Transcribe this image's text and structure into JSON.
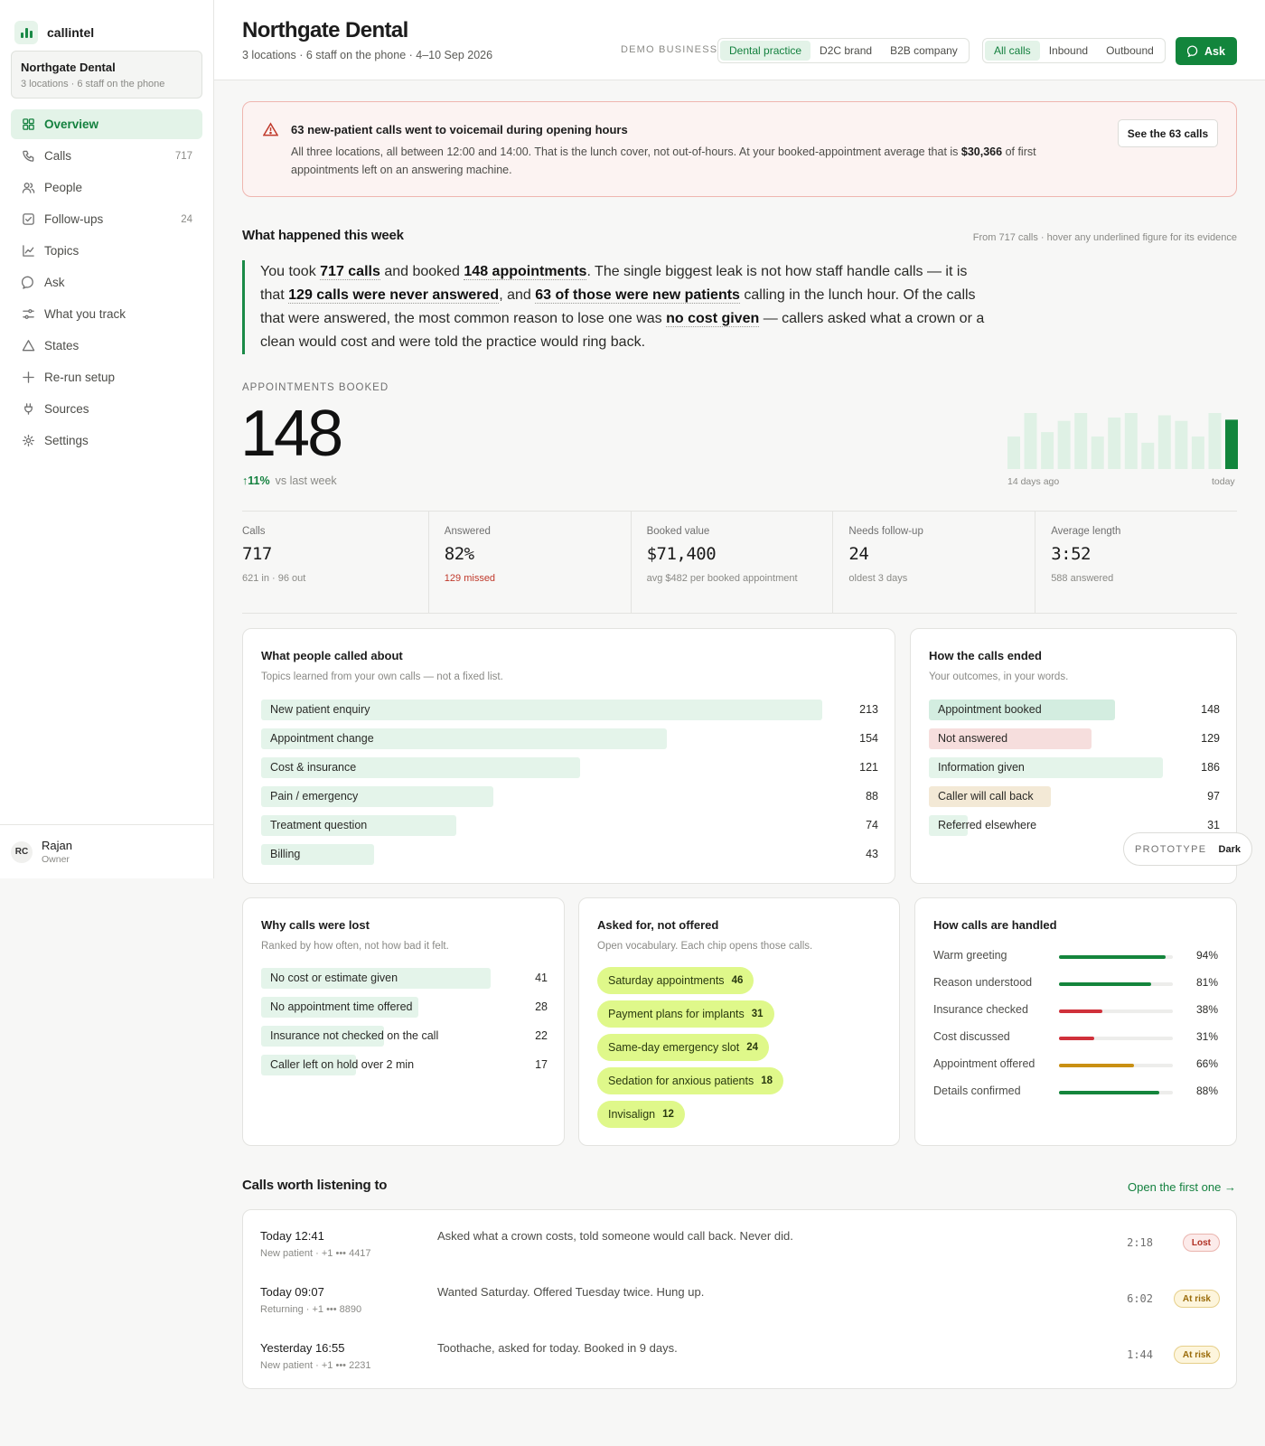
{
  "app": {
    "name": "callintel"
  },
  "org": {
    "name": "Northgate Dental",
    "subtitle": "3 locations · 6 staff on the phone"
  },
  "nav": [
    {
      "label": "Overview",
      "count": "",
      "icon": "grid-icon",
      "active": true
    },
    {
      "label": "Calls",
      "count": "717",
      "icon": "phone-icon"
    },
    {
      "label": "People",
      "count": "",
      "icon": "people-icon"
    },
    {
      "label": "Follow-ups",
      "count": "24",
      "icon": "checkbox-icon"
    },
    {
      "label": "Topics",
      "count": "",
      "icon": "line-chart-icon"
    },
    {
      "label": "Ask",
      "count": "",
      "icon": "chat-icon"
    },
    {
      "label": "What you track",
      "count": "",
      "icon": "sliders-icon"
    },
    {
      "label": "States",
      "count": "",
      "icon": "warning-icon"
    },
    {
      "label": "Re-run setup",
      "count": "",
      "icon": "plus-icon"
    },
    {
      "label": "Sources",
      "count": "",
      "icon": "plug-icon"
    },
    {
      "label": "Settings",
      "count": "",
      "icon": "gear-icon"
    }
  ],
  "user": {
    "initials": "RC",
    "name": "Rajan",
    "role": "Owner"
  },
  "header": {
    "title": "Northgate Dental",
    "subtitle": "3 locations · 6 staff on the phone · 4–10 Sep 2026",
    "demo_label": "DEMO BUSINESS",
    "business_types": [
      "Dental practice",
      "D2C brand",
      "B2B company"
    ],
    "business_selected": "Dental practice",
    "directions": [
      "All calls",
      "Inbound",
      "Outbound"
    ],
    "direction_selected": "All calls",
    "ask_label": "Ask"
  },
  "alert": {
    "title": "63 new-patient calls went to voicemail during opening hours",
    "body_before": "All three locations, all between 12:00 and 14:00. That is the lunch cover, not out-of-hours. At your booked-appointment average that is ",
    "body_amount": "$30,366",
    "body_after": " of first appointments left on an answering machine.",
    "button": "See the 63 calls"
  },
  "week": {
    "title": "What happened this week",
    "note": "From 717 calls · hover any underlined figure for its evidence",
    "s1": "You took ",
    "h1": "717 calls",
    "s2": " and booked ",
    "h2": "148 appointments",
    "s3": ". The single biggest leak is not how staff handle calls — it is that ",
    "h3": "129 calls were never answered",
    "s4": ", and ",
    "h4": "63 of those were new patients",
    "s5": " calling in the lunch hour. Of the calls that were answered, the most common reason to lose one was ",
    "h5": "no cost given",
    "s6": " — callers asked what a crown or a clean would cost and were told the practice would ring back."
  },
  "appointments": {
    "label": "APPOINTMENTS BOOKED",
    "value": "148",
    "delta": "11%",
    "delta_note": "vs last week",
    "spark_left": "14 days ago",
    "spark_right": "today",
    "spark_values": [
      0.58,
      1.0,
      0.66,
      0.86,
      1.0,
      0.58,
      0.92,
      1.0,
      0.47,
      0.96,
      0.86,
      0.58,
      1.0,
      0.88
    ]
  },
  "stats": [
    {
      "label": "Calls",
      "value": "717",
      "sub": "621 in · 96 out",
      "red": false
    },
    {
      "label": "Answered",
      "value": "82%",
      "sub": "129 missed",
      "red": true
    },
    {
      "label": "Booked value",
      "value": "$71,400",
      "sub": "avg $482 per booked appointment",
      "red": false
    },
    {
      "label": "Needs follow-up",
      "value": "24",
      "sub": "oldest 3 days",
      "red": false
    },
    {
      "label": "Average length",
      "value": "3:52",
      "sub": "588 answered",
      "red": false
    }
  ],
  "topics": {
    "title": "What people called about",
    "subtitle": "Topics learned from your own calls — not a fixed list.",
    "max": 213,
    "items": [
      {
        "label": "New patient enquiry",
        "value": 213
      },
      {
        "label": "Appointment change",
        "value": 154
      },
      {
        "label": "Cost & insurance",
        "value": 121
      },
      {
        "label": "Pain / emergency",
        "value": 88
      },
      {
        "label": "Treatment question",
        "value": 74
      },
      {
        "label": "Billing",
        "value": 43
      }
    ]
  },
  "outcomes": {
    "title": "How the calls ended",
    "subtitle": "Your outcomes, in your words.",
    "max": 186,
    "items": [
      {
        "label": "Appointment booked",
        "value": 148,
        "color": "#d3ede0"
      },
      {
        "label": "Not answered",
        "value": 129,
        "color": "#f6dedd"
      },
      {
        "label": "Information given",
        "value": 186,
        "color": "#e4f4ea"
      },
      {
        "label": "Caller will call back",
        "value": 97,
        "color": "#f3e9d6"
      },
      {
        "label": "Referred elsewhere",
        "value": 31,
        "color": "#e4f4ea"
      }
    ]
  },
  "lost": {
    "title": "Why calls were lost",
    "subtitle": "Ranked by how often, not how bad it felt.",
    "max": 41,
    "items": [
      {
        "label": "No cost or estimate given",
        "value": 41
      },
      {
        "label": "No appointment time offered",
        "value": 28
      },
      {
        "label": "Insurance not checked on the call",
        "value": 22
      },
      {
        "label": "Caller left on hold over 2 min",
        "value": 17
      }
    ]
  },
  "asked": {
    "title": "Asked for, not offered",
    "subtitle": "Open vocabulary. Each chip opens those calls.",
    "chips": [
      {
        "label": "Saturday appointments",
        "count": "46"
      },
      {
        "label": "Payment plans for implants",
        "count": "31"
      },
      {
        "label": "Same-day emergency slot",
        "count": "24"
      },
      {
        "label": "Sedation for anxious patients",
        "count": "18"
      },
      {
        "label": "Invisalign",
        "count": "12"
      }
    ]
  },
  "handling": {
    "title": "How calls are handled",
    "items": [
      {
        "label": "Warm greeting",
        "value": 94,
        "display": "94%",
        "color": "#14853c"
      },
      {
        "label": "Reason understood",
        "value": 81,
        "display": "81%",
        "color": "#14853c"
      },
      {
        "label": "Insurance checked",
        "value": 38,
        "display": "38%",
        "color": "#d0313b"
      },
      {
        "label": "Cost discussed",
        "value": 31,
        "display": "31%",
        "color": "#d0313b"
      },
      {
        "label": "Appointment offered",
        "value": 66,
        "display": "66%",
        "color": "#c99013"
      },
      {
        "label": "Details confirmed",
        "value": 88,
        "display": "88%",
        "color": "#14853c"
      }
    ]
  },
  "listen": {
    "title": "Calls worth listening to",
    "link": "Open the first one →",
    "calls": [
      {
        "when": "Today 12:41",
        "who": "New patient · +1 ••• 4417",
        "desc": "Asked what a crown costs, told someone would call back. Never did.",
        "duration": "2:18",
        "status": "Lost",
        "kind": "lost"
      },
      {
        "when": "Today 09:07",
        "who": "Returning · +1 ••• 8890",
        "desc": "Wanted Saturday. Offered Tuesday twice. Hung up.",
        "duration": "6:02",
        "status": "At risk",
        "kind": "risk"
      },
      {
        "when": "Yesterday 16:55",
        "who": "New patient · +1 ••• 2231",
        "desc": "Toothache, asked for today. Booked in 9 days.",
        "duration": "1:44",
        "status": "At risk",
        "kind": "risk"
      }
    ]
  },
  "prototype": {
    "label": "PROTOTYPE",
    "toggle": "Dark"
  }
}
